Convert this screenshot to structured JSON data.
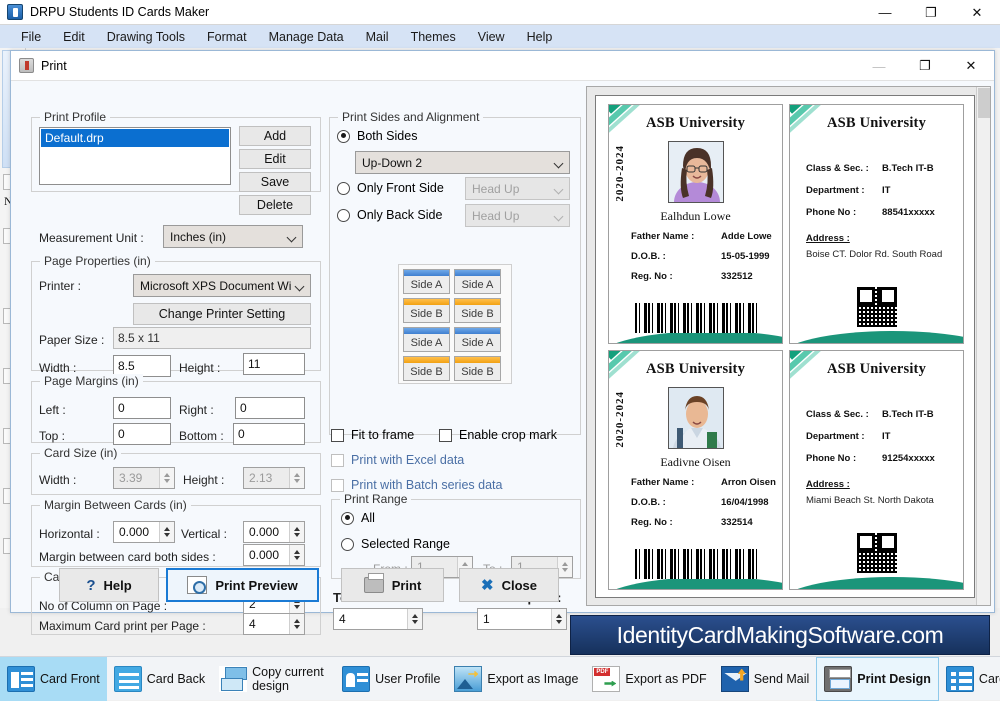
{
  "app": {
    "title": "DRPU Students ID Cards Maker",
    "window_buttons": {
      "minimize": "—",
      "maximize": "❐",
      "close": "✕"
    },
    "menu": [
      "File",
      "Edit",
      "Drawing Tools",
      "Format",
      "Manage Data",
      "Mail",
      "Themes",
      "View",
      "Help"
    ],
    "left_strip_letter": "N"
  },
  "dialog": {
    "title": "Print",
    "window_buttons": {
      "minimize": "—",
      "maximize": "❐",
      "close": "✕"
    },
    "print_profile": {
      "group_title": "Print Profile",
      "items": [
        "Default.drp"
      ],
      "selected": "Default.drp",
      "buttons": [
        "Add",
        "Edit",
        "Save",
        "Delete"
      ]
    },
    "measurement_unit": {
      "label": "Measurement Unit :",
      "value": "Inches (in)"
    },
    "page_properties": {
      "group_title": "Page Properties (in)",
      "printer_label": "Printer :",
      "printer_value": "Microsoft XPS Document Wi",
      "change_printer_button": "Change Printer Setting",
      "paper_size_label": "Paper Size :",
      "paper_size_value": "8.5 x 11",
      "width_label": "Width :",
      "width_value": "8.5",
      "height_label": "Height :",
      "height_value": "11"
    },
    "page_margins": {
      "group_title": "Page Margins (in)",
      "left_label": "Left :",
      "left_value": "0",
      "right_label": "Right :",
      "right_value": "0",
      "top_label": "Top :",
      "top_value": "0",
      "bottom_label": "Bottom :",
      "bottom_value": "0"
    },
    "card_size": {
      "group_title": "Card Size (in)",
      "width_label": "Width :",
      "width_value": "3.39",
      "height_label": "Height :",
      "height_value": "2.13"
    },
    "margin_between_cards": {
      "group_title": "Margin Between Cards (in)",
      "horizontal_label": "Horizontal :",
      "horizontal_value": "0.000",
      "vertical_label": "Vertical :",
      "vertical_value": "0.000",
      "both_sides_label": "Margin between card both sides :",
      "both_sides_value": "0.000"
    },
    "card_spacing": {
      "group_title": "Card Spacing",
      "columns_label": "No of Column on Page :",
      "columns_value": "2",
      "max_cards_label": "Maximum Card print per Page :",
      "max_cards_value": "4"
    },
    "print_sides": {
      "group_title": "Print Sides and Alignment",
      "both_sides_label": "Both Sides",
      "both_sides_selected": true,
      "both_sides_mode": "Up-Down 2",
      "only_front_label": "Only Front Side",
      "only_front_mode": "Head Up",
      "only_back_label": "Only Back Side",
      "only_back_mode": "Head Up",
      "matrix": [
        "Side A",
        "Side A",
        "Side B",
        "Side B",
        "Side A",
        "Side A",
        "Side B",
        "Side B"
      ]
    },
    "options": {
      "fit_to_frame": "Fit to frame",
      "fit_to_frame_checked": false,
      "enable_crop_mark": "Enable crop mark",
      "enable_crop_mark_checked": false,
      "print_with_excel": "Print with Excel data",
      "print_with_excel_checked": false,
      "print_with_batch": "Print with Batch series data",
      "print_with_batch_checked": false
    },
    "print_range": {
      "group_title": "Print Range",
      "all_label": "All",
      "all_selected": true,
      "selected_range_label": "Selected Range",
      "from_label": "From :",
      "from_value": "1",
      "to_label": "To :",
      "to_value": "1"
    },
    "totals": {
      "total_cards_label": "Total Cards :",
      "total_cards_value": "4",
      "print_copies_label": "Print Copies :",
      "print_copies_value": "1"
    },
    "footer_buttons": [
      {
        "label": "Help",
        "icon": "question-icon",
        "primary": false
      },
      {
        "label": "Print Preview",
        "icon": "magnifier-icon",
        "primary": true
      },
      {
        "label": "Print",
        "icon": "printer-icon",
        "primary": false
      },
      {
        "label": "Close",
        "icon": "close-x-icon",
        "primary": false
      }
    ]
  },
  "preview": {
    "cards": [
      {
        "side": "front",
        "university": "ASB University",
        "year": "2020-2024",
        "student_name": "Ealhdun Lowe",
        "fields": [
          {
            "label": "Father Name :",
            "value": "Adde Lowe"
          },
          {
            "label": "D.O.B. :",
            "value": "15-05-1999"
          },
          {
            "label": "Reg. No :",
            "value": "332512"
          }
        ]
      },
      {
        "side": "back",
        "university": "ASB University",
        "fields": [
          {
            "label": "Class & Sec. :",
            "value": "B.Tech IT-B"
          },
          {
            "label": "Department :",
            "value": "IT"
          },
          {
            "label": "Phone No :",
            "value": "88541xxxxx"
          }
        ],
        "address_heading": "Address :",
        "address_value": "Boise CT. Dolor Rd. South Road"
      },
      {
        "side": "front",
        "university": "ASB University",
        "year": "2020-2024",
        "student_name": "Eadivne Oisen",
        "fields": [
          {
            "label": "Father Name :",
            "value": "Arron Oisen"
          },
          {
            "label": "D.O.B. :",
            "value": "16/04/1998"
          },
          {
            "label": "Reg. No :",
            "value": "332514"
          }
        ]
      },
      {
        "side": "back",
        "university": "ASB University",
        "fields": [
          {
            "label": "Class & Sec. :",
            "value": "B.Tech IT-B"
          },
          {
            "label": "Department :",
            "value": "IT"
          },
          {
            "label": "Phone No :",
            "value": "91254xxxxx"
          }
        ],
        "address_heading": "Address :",
        "address_value": "Miami Beach St. North Dakota"
      }
    ]
  },
  "brand": {
    "text": "IdentityCardMakingSoftware.com"
  },
  "taskbar": {
    "items": [
      {
        "label": "Card Front",
        "icon": "card-front-icon",
        "state": "active"
      },
      {
        "label": "Card Back",
        "icon": "card-back-icon",
        "state": "normal"
      },
      {
        "label": "Copy current design",
        "icon": "copy-design-icon",
        "state": "normal"
      },
      {
        "label": "User Profile",
        "icon": "user-profile-icon",
        "state": "normal"
      },
      {
        "label": "Export as Image",
        "icon": "export-image-icon",
        "state": "normal"
      },
      {
        "label": "Export as PDF",
        "icon": "export-pdf-icon",
        "state": "normal"
      },
      {
        "label": "Send Mail",
        "icon": "send-mail-icon",
        "state": "normal"
      },
      {
        "label": "Print Design",
        "icon": "print-design-icon",
        "state": "boxed"
      },
      {
        "label": "Card Batch Data",
        "icon": "card-batch-icon",
        "state": "normal"
      }
    ]
  },
  "colors": {
    "accent": "#1a7ad4",
    "teal": "#13a07c",
    "brand_bg": "#2b4f8e",
    "select": "#0b6fd0"
  }
}
